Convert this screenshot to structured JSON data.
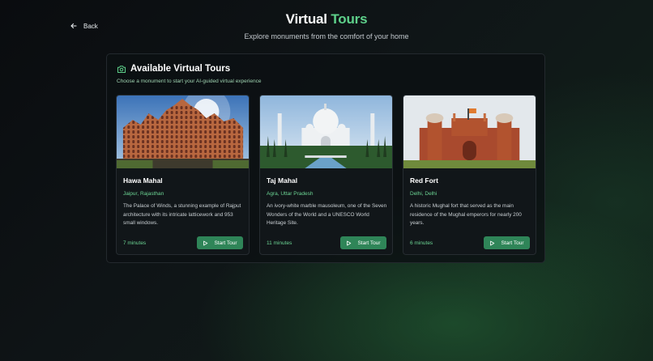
{
  "nav": {
    "back_label": "Back"
  },
  "header": {
    "title_main": "Virtual",
    "title_accent": "Tours",
    "subtitle": "Explore monuments from the comfort of your home"
  },
  "panel": {
    "title": "Available Virtual Tours",
    "subtitle": "Choose a monument to start your AI-guided virtual experience"
  },
  "tours": [
    {
      "name": "Hawa Mahal",
      "location": "Jaipur, Rajasthan",
      "description": "The Palace of Winds, a stunning example of Rajput architecture with its intricate latticework and 953 small windows.",
      "duration": "7 minutes",
      "button": "Start Tour"
    },
    {
      "name": "Taj Mahal",
      "location": "Agra, Uttar Pradesh",
      "description": "An ivory-white marble mausoleum, one of the Seven Wonders of the World and a UNESCO World Heritage Site.",
      "duration": "11 minutes",
      "button": "Start Tour"
    },
    {
      "name": "Red Fort",
      "location": "Delhi, Delhi",
      "description": "A historic Mughal fort that served as the main residence of the Mughal emperors for nearly 200 years.",
      "duration": "6 minutes",
      "button": "Start Tour"
    }
  ],
  "colors": {
    "accent": "#5ed18b",
    "button": "#2f8558",
    "panel_bg": "#0c1013"
  }
}
